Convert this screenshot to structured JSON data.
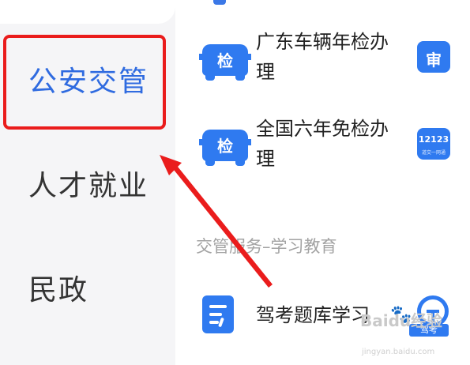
{
  "sidebar": {
    "items": [
      {
        "label": "公安交管",
        "active": true
      },
      {
        "label": "人才就业",
        "active": false
      },
      {
        "label": "民政",
        "active": false
      }
    ]
  },
  "services": [
    {
      "title_line1": "广东车辆年检办",
      "title_line2": "理",
      "icon_glyph": "检",
      "icon": "car-inspection-icon"
    },
    {
      "title_line1": "全国六年免检办",
      "title_line2": "理",
      "icon_glyph": "检",
      "icon": "car-inspection-icon"
    }
  ],
  "right_icons": [
    {
      "glyph": "审",
      "icon": "car-review-icon"
    },
    {
      "glyph": "12123",
      "sub": "道交一网通",
      "icon": "app-12123-icon"
    }
  ],
  "section": {
    "title": "交管服务–学习教育"
  },
  "study_item": {
    "title": "驾考题库学习",
    "icon": "document-icon"
  },
  "wheel_label": "驾考",
  "watermark": {
    "brand": "Baidu经验",
    "url": "jingyan.baidu.com"
  },
  "colors": {
    "accent": "#2f7af0",
    "highlight": "#ea1c1c",
    "sidebar_bg": "#f5f5f7"
  }
}
